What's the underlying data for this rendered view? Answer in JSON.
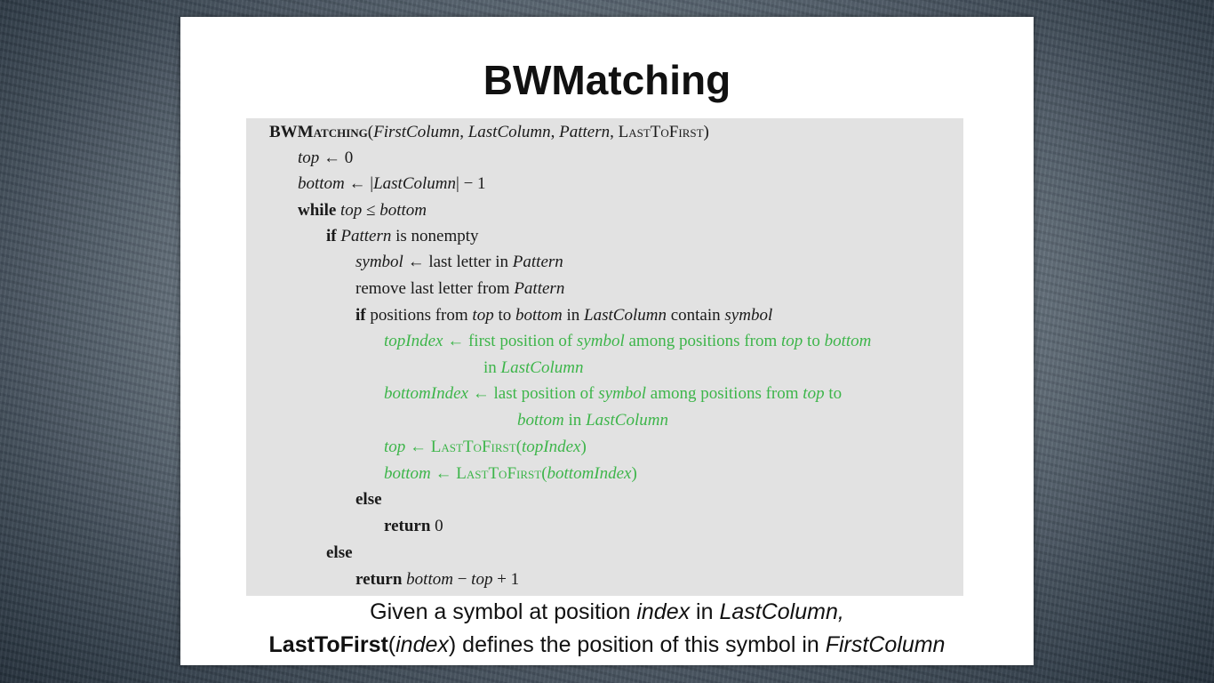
{
  "slide": {
    "title": "BWMatching",
    "code": {
      "signature": {
        "name": "BWMatching",
        "open_paren": "(",
        "p1": "FirstColumn",
        "sep1": ", ",
        "p2": "LastColumn",
        "sep2": ", ",
        "p3": "Pattern",
        "sep3": ", ",
        "p4": "LastToFirst",
        "close_paren": ")"
      },
      "l1": {
        "v": "top",
        "op": " ← 0"
      },
      "l2": {
        "v": "bottom",
        "op": " ← |",
        "v2": "LastColumn",
        "rest": "| − 1"
      },
      "l3": {
        "kw": "while",
        "sp": " ",
        "v": "top",
        "op": " ≤ ",
        "v2": "bottom"
      },
      "l4": {
        "kw": "if",
        "sp": " ",
        "v": "Pattern",
        "rest": " is nonempty"
      },
      "l5": {
        "v": "symbol",
        "rest": " ← last letter in ",
        "v2": "Pattern"
      },
      "l6": {
        "text": "remove last letter from ",
        "v": "Pattern"
      },
      "l7": {
        "kw": "if",
        "t1": " positions from ",
        "v1": "top",
        "t2": " to ",
        "v2": "bottom",
        "t3": " in ",
        "v3": "LastColumn",
        "t4": " contain ",
        "v4": "symbol"
      },
      "l8": {
        "v1": "topIndex",
        "t1": " ← first position of ",
        "v2": "symbol",
        "t2": " among positions from ",
        "v3": "top",
        "t3": " to ",
        "v4": "bottom"
      },
      "l9": {
        "t1": "in ",
        "v1": "LastColumn"
      },
      "l10": {
        "v1": "bottomIndex",
        "t1": " ← last position of ",
        "v2": "symbol",
        "t2": " among positions from ",
        "v3": "top",
        "t3": " to"
      },
      "l11": {
        "v1": "bottom",
        "t1": " in ",
        "v2": "LastColumn"
      },
      "l12": {
        "v1": "top",
        "t1": " ← ",
        "fn": "LastToFirst",
        "open": "(",
        "arg": "topIndex",
        "close": ")"
      },
      "l13": {
        "v1": "bottom",
        "t1": " ← ",
        "fn": "LastToFirst",
        "open": "(",
        "arg": "bottomIndex",
        "close": ")"
      },
      "l14": {
        "kw": "else"
      },
      "l15": {
        "kw": "return",
        "rest": " 0"
      },
      "l16": {
        "kw": "else"
      },
      "l17": {
        "kw": "return",
        "sp": " ",
        "v1": "bottom",
        "t1": " − ",
        "v2": "top",
        "t2": " + 1"
      }
    },
    "caption": {
      "line1_a": "Given a symbol at position ",
      "line1_b": "index",
      "line1_c": " in ",
      "line1_d": "LastColumn,",
      "line2_a": "LastToFirst",
      "line2_b": "(",
      "line2_c": "index",
      "line2_d": ")  defines the position of this symbol in ",
      "line2_e": "FirstColumn"
    }
  },
  "colors": {
    "highlight": "#3db54a",
    "code_bg": "#e2e2e2"
  }
}
